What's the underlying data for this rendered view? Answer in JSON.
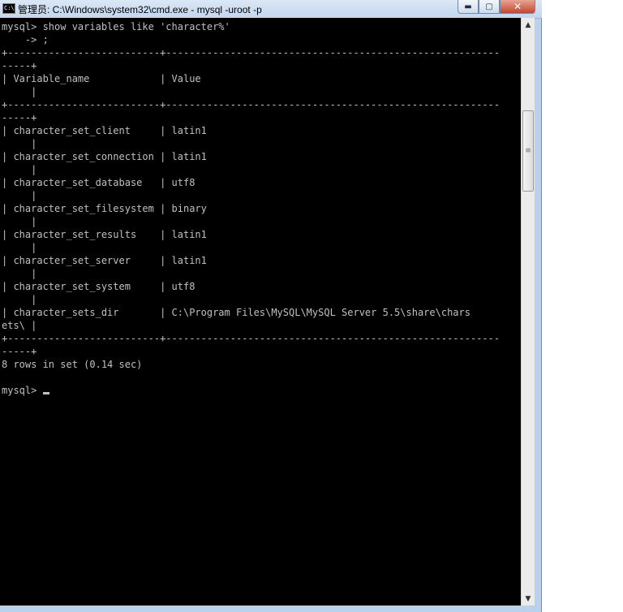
{
  "window": {
    "title": "管理员: C:\\Windows\\system32\\cmd.exe - mysql  -uroot -p",
    "icon_label": "C:\\",
    "controls": {
      "minimize": "▬",
      "maximize": "▢",
      "close": "✕"
    }
  },
  "console": {
    "lines": [
      "mysql> show variables like 'character%'",
      "    -> ;",
      "+--------------------------+---------------------------------------------------------",
      "-----+",
      "| Variable_name            | Value",
      "     |",
      "+--------------------------+---------------------------------------------------------",
      "-----+",
      "| character_set_client     | latin1",
      "     |",
      "| character_set_connection | latin1",
      "     |",
      "| character_set_database   | utf8",
      "     |",
      "| character_set_filesystem | binary",
      "     |",
      "| character_set_results    | latin1",
      "     |",
      "| character_set_server     | latin1",
      "     |",
      "| character_set_system     | utf8",
      "     |",
      "| character_sets_dir       | C:\\Program Files\\MySQL\\MySQL Server 5.5\\share\\chars",
      "ets\\ |",
      "+--------------------------+---------------------------------------------------------",
      "-----+",
      "8 rows in set (0.14 sec)",
      "",
      "mysql> "
    ]
  },
  "scrollbar": {
    "up_arrow": "▲",
    "down_arrow": "▼",
    "grip": "≡"
  }
}
